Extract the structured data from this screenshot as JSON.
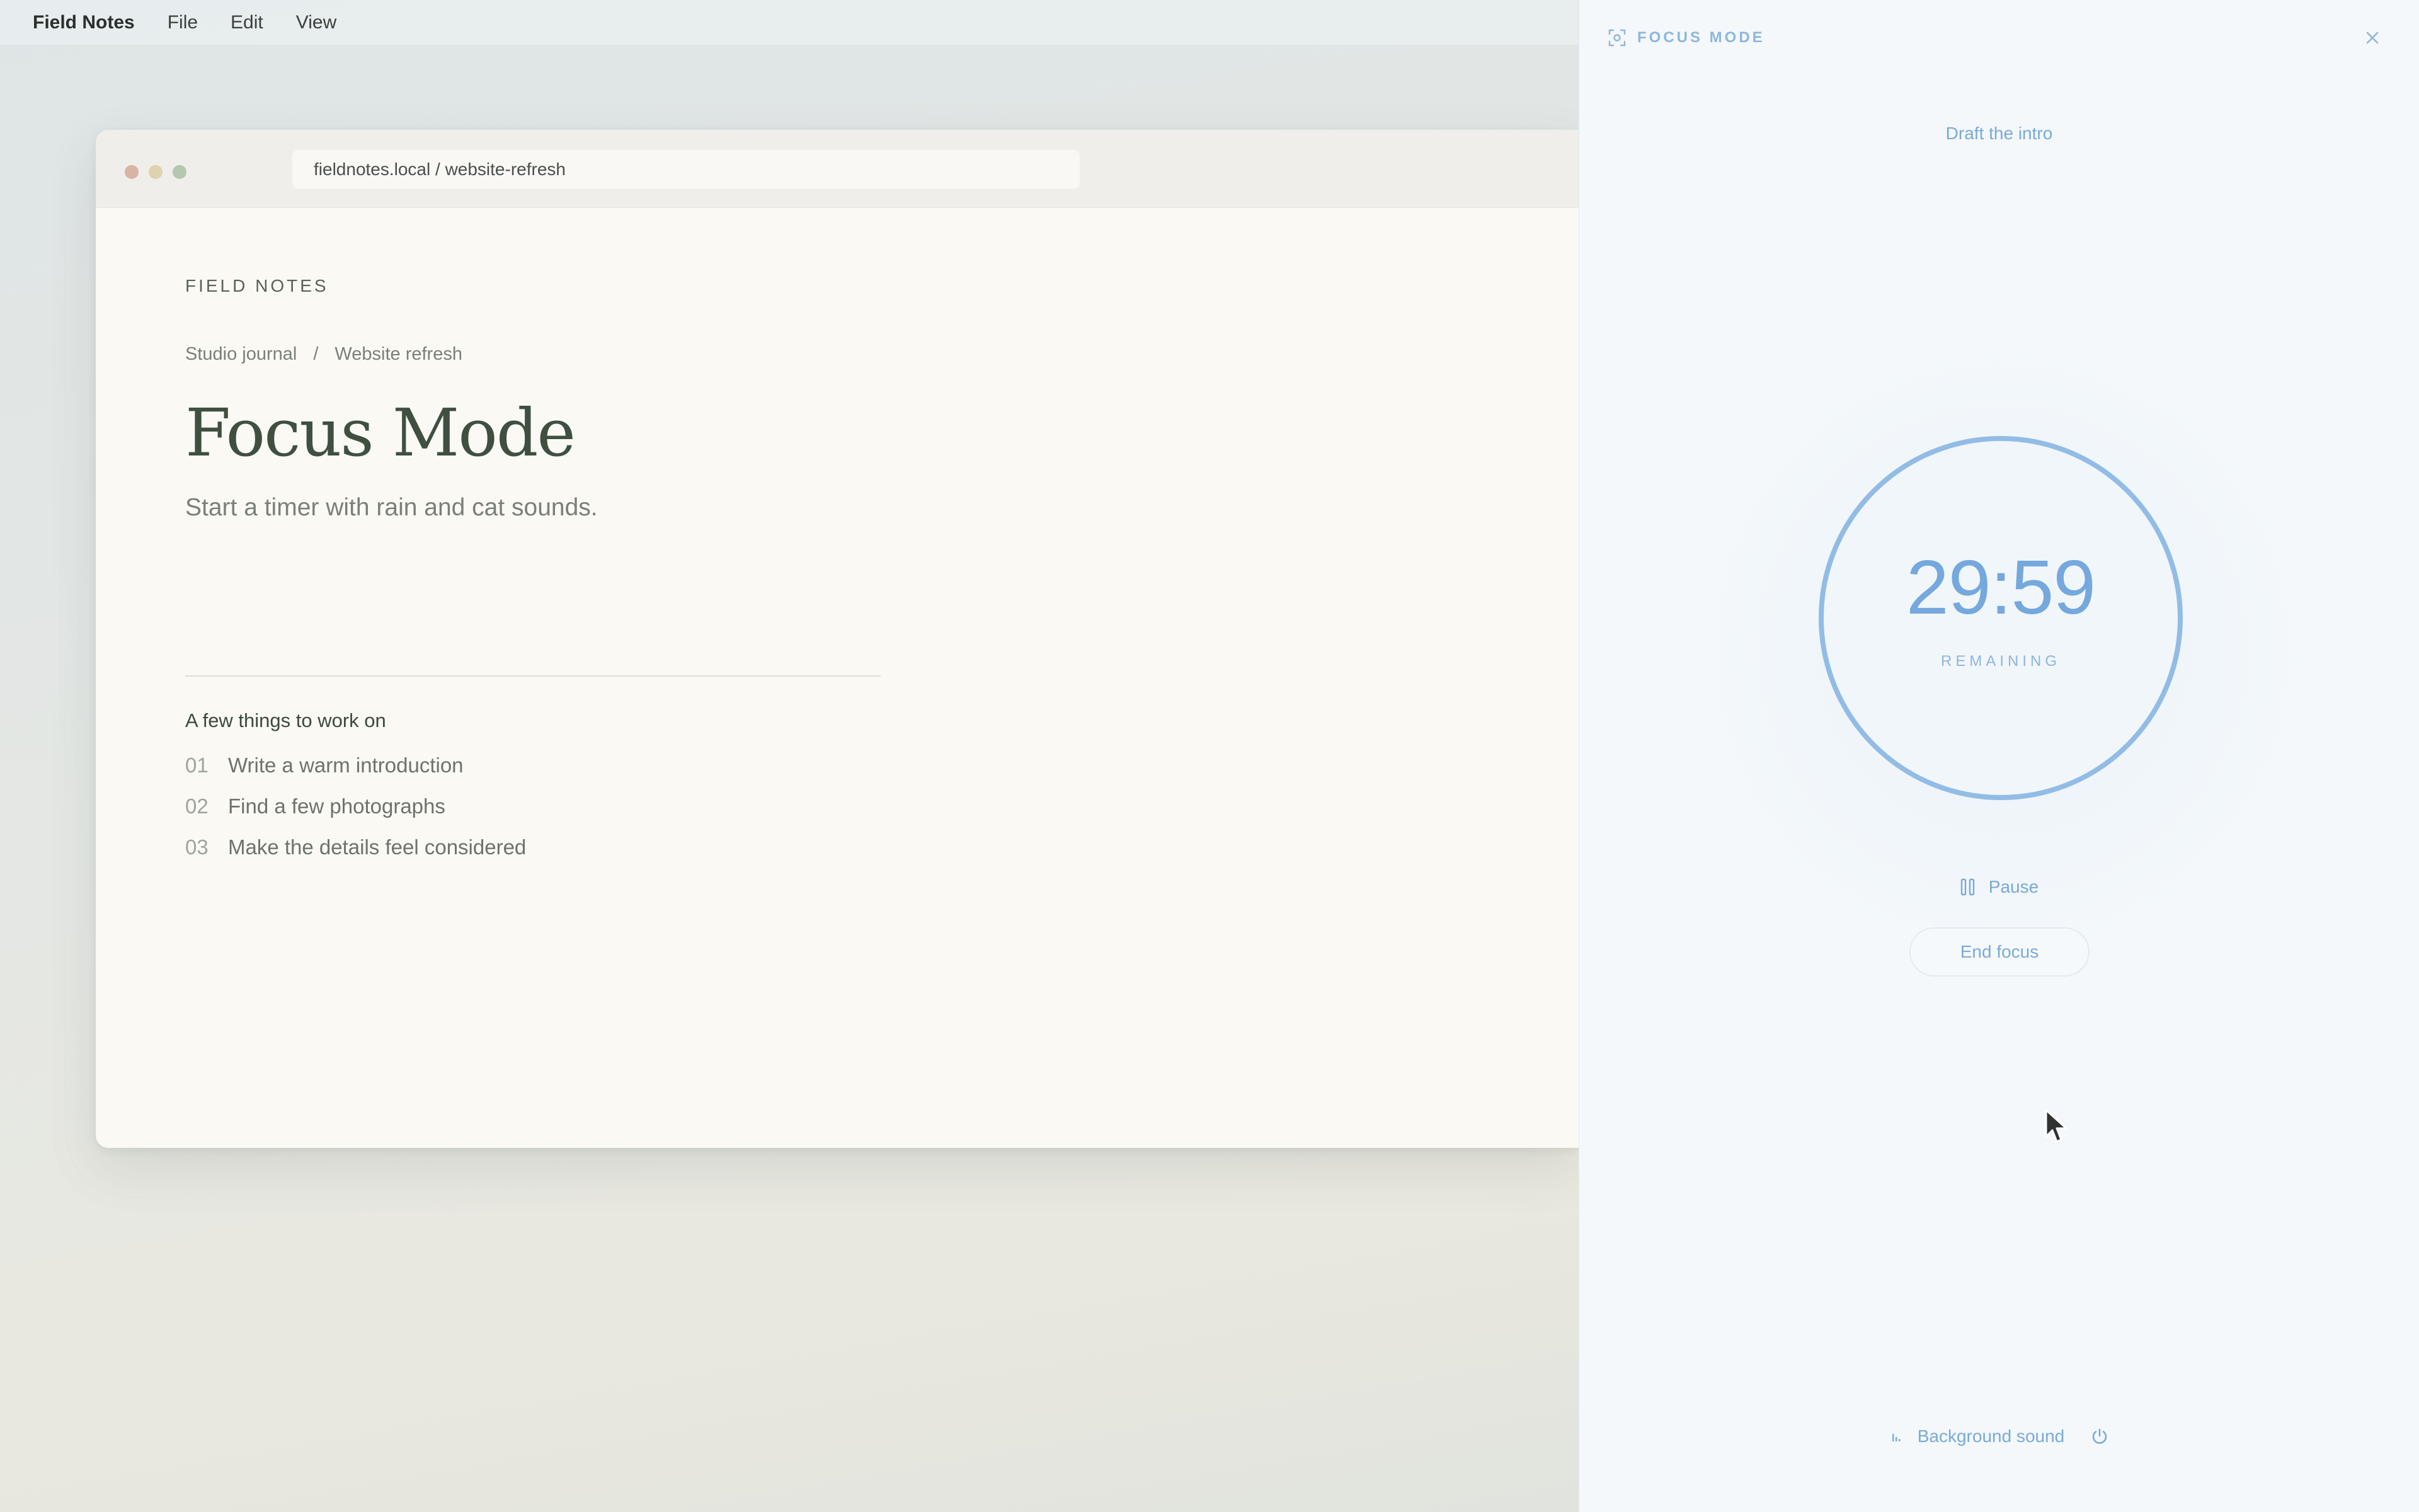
{
  "menubar": {
    "app_name": "Field Notes",
    "items": [
      {
        "label": "File"
      },
      {
        "label": "Edit"
      },
      {
        "label": "View"
      }
    ]
  },
  "browser": {
    "url": "fieldnotes.local / website-refresh"
  },
  "page": {
    "brand": "FIELD NOTES",
    "breadcrumb": [
      "Studio journal",
      "/",
      "Website refresh"
    ],
    "title": "Focus Mode",
    "subtitle": "Start a timer with rain and cat sounds.",
    "list_heading": "A few things to work on",
    "tasks": [
      {
        "num": "01",
        "text": "Write a warm introduction"
      },
      {
        "num": "02",
        "text": "Find a few photographs"
      },
      {
        "num": "03",
        "text": "Make the details feel considered"
      }
    ]
  },
  "focus_panel": {
    "header_label": "FOCUS MODE",
    "header_icon": "focus-icon",
    "close_icon": "close-icon",
    "task_name": "Draft the intro",
    "time": "29:59",
    "time_label": "REMAINING",
    "pause_label": "Pause",
    "end_label": "End focus",
    "sound_label": "Background sound",
    "accent_color": "#7aaad8",
    "ring_color": "#92bce5"
  }
}
